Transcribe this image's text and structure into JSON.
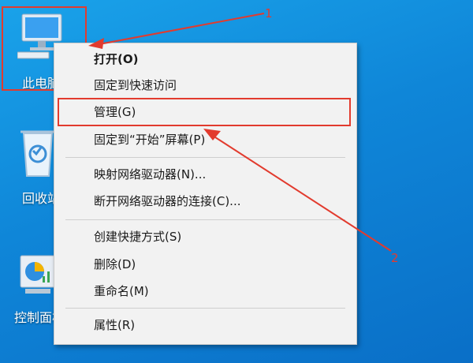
{
  "desktop": {
    "icons": [
      {
        "name": "this-pc",
        "label": "此电脑"
      },
      {
        "name": "recycle-bin",
        "label": "回收站"
      },
      {
        "name": "control-panel",
        "label": "控制面板"
      }
    ]
  },
  "context_menu": {
    "items": [
      {
        "label": "打开(O)",
        "bold": true
      },
      {
        "label": "固定到快速访问"
      },
      {
        "label": "管理(G)"
      },
      {
        "label": "固定到“开始”屏幕(P)"
      },
      {
        "label": "映射网络驱动器(N)..."
      },
      {
        "label": "断开网络驱动器的连接(C)..."
      },
      {
        "label": "创建快捷方式(S)"
      },
      {
        "label": "删除(D)"
      },
      {
        "label": "重命名(M)"
      },
      {
        "label": "属性(R)"
      }
    ]
  },
  "annotations": {
    "step1": "1",
    "step2": "2",
    "color": "#e23b2e"
  }
}
